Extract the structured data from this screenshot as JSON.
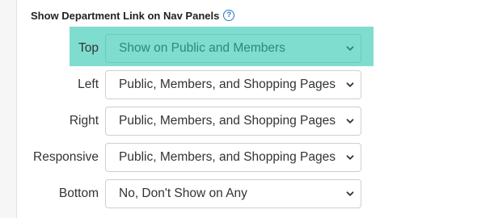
{
  "section": {
    "title": "Show Department Link on Nav Panels",
    "help_icon": "question-circle-icon"
  },
  "highlight_color": "#7fddd0",
  "rows": [
    {
      "label": "Top",
      "value": "Show on Public and Members",
      "highlighted": true
    },
    {
      "label": "Left",
      "value": "Public, Members, and Shopping Pages",
      "highlighted": false
    },
    {
      "label": "Right",
      "value": "Public, Members, and Shopping Pages",
      "highlighted": false
    },
    {
      "label": "Responsive",
      "value": "Public, Members, and Shopping Pages",
      "highlighted": false
    },
    {
      "label": "Bottom",
      "value": "No, Don't Show on Any",
      "highlighted": false
    }
  ]
}
